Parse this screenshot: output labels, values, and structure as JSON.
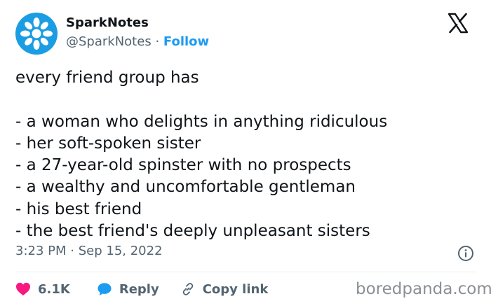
{
  "account": {
    "name": "SparkNotes",
    "handle": "@SparkNotes",
    "separator": "·",
    "follow_label": "Follow",
    "avatar_color": "#1a9de3"
  },
  "tweet": {
    "text": "every friend group has\n\n- a woman who delights in anything ridiculous\n- her soft-spoken sister\n- a 27-year-old spinster with no prospects\n- a wealthy and uncomfortable gentleman\n- his best friend\n- the best friend's deeply unpleasant sisters",
    "time": "3:23 PM",
    "date": "Sep 15, 2022"
  },
  "actions": {
    "likes": "6.1K",
    "reply_label": "Reply",
    "copy_label": "Copy link"
  },
  "watermark": "boredpanda.com",
  "colors": {
    "accent": "#1d9bf0",
    "like": "#f91880",
    "muted": "#536471"
  },
  "icons": [
    "sparknotes-logo-icon",
    "x-logo-icon",
    "info-icon",
    "heart-icon",
    "speech-bubble-icon",
    "link-icon"
  ]
}
